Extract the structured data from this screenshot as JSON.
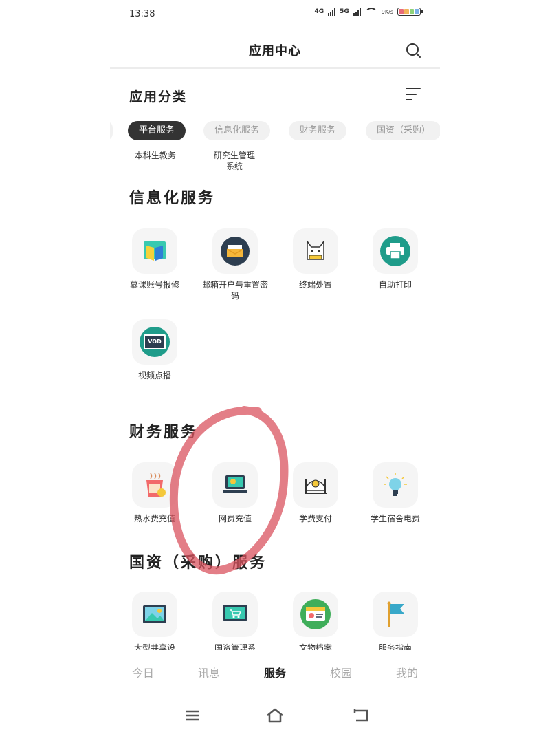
{
  "status_bar": {
    "time": "13:38",
    "network_1": "4G",
    "network_2": "5G",
    "speed": "9K/s"
  },
  "header": {
    "title": "应用中心",
    "search_icon": "search-icon"
  },
  "categories": {
    "title": "应用分类",
    "filter_icon": "menu-lines-icon",
    "chips": [
      "平台服务",
      "信息化服务",
      "财务服务",
      "国资（采购）"
    ],
    "active_chip": "平台服务",
    "platform_items": [
      "本科生教务",
      "研究生管理\n系统"
    ]
  },
  "sections": {
    "info": {
      "title": "信息化服务",
      "apps": [
        {
          "label": "慕课账号报修",
          "icon": "mooc-book-icon"
        },
        {
          "label": "邮箱开户与重置密码",
          "icon": "mail-icon"
        },
        {
          "label": "终端处置",
          "icon": "terminal-cat-icon"
        },
        {
          "label": "自助打印",
          "icon": "printer-icon"
        },
        {
          "label": "视频点播",
          "icon": "vod-icon",
          "icon_text": "VOD"
        }
      ]
    },
    "finance": {
      "title": "财务服务",
      "apps": [
        {
          "label": "热水费充值",
          "icon": "hot-water-cup-icon"
        },
        {
          "label": "网费充值",
          "icon": "laptop-coin-icon"
        },
        {
          "label": "学费支付",
          "icon": "tuition-scale-icon"
        },
        {
          "label": "学生宿舍电费",
          "icon": "lightbulb-icon"
        }
      ]
    },
    "assets": {
      "title": "国资（采购）服务",
      "apps": [
        {
          "label": "大型共享设",
          "icon": "picture-frame-icon"
        },
        {
          "label": "国资管理系",
          "icon": "cart-monitor-icon"
        },
        {
          "label": "文物档案",
          "icon": "id-card-icon"
        },
        {
          "label": "服务指南",
          "icon": "flag-icon"
        }
      ]
    }
  },
  "bottom_nav": {
    "items": [
      "今日",
      "讯息",
      "服务",
      "校园",
      "我的"
    ],
    "active": "服务"
  },
  "system_bar": {
    "icons": [
      "recent-apps-icon",
      "home-icon",
      "back-icon"
    ]
  },
  "colors": {
    "accent_dark": "#333333",
    "teal": "#1f9c8a",
    "annotation_red": "#d9535f"
  }
}
